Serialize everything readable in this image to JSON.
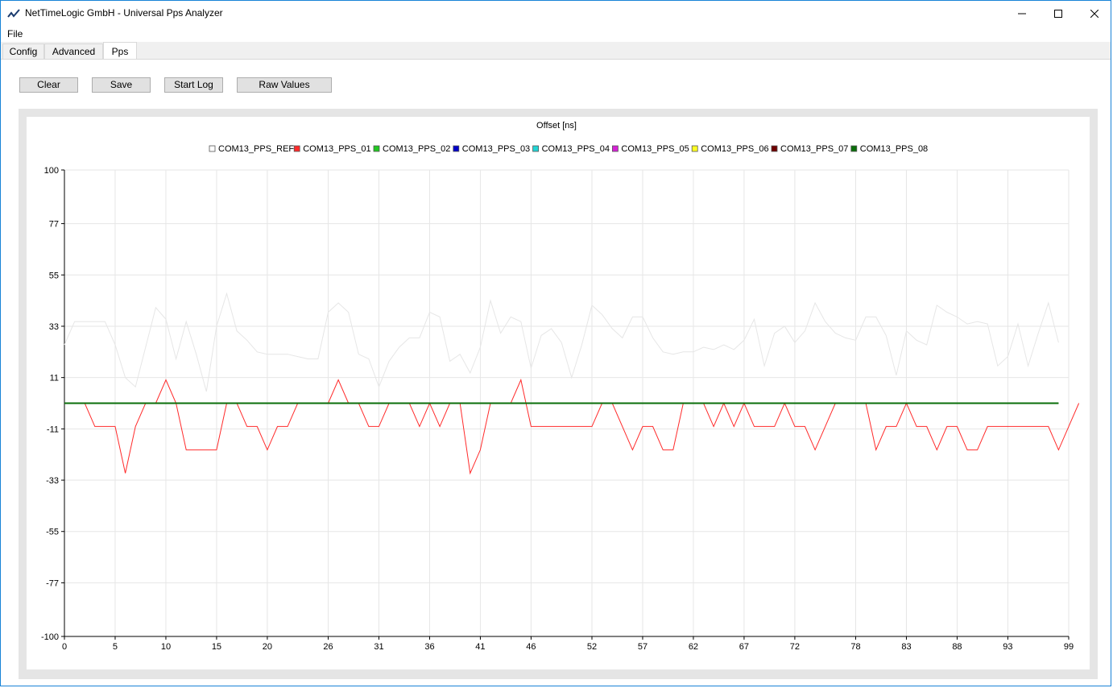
{
  "window": {
    "title": "NetTimeLogic GmbH - Universal Pps Analyzer",
    "accent": "#1883d7"
  },
  "menu": {
    "file": "File"
  },
  "tabs": [
    "Config",
    "Advanced",
    "Pps"
  ],
  "active_tab": "Pps",
  "toolbar": {
    "clear": "Clear",
    "save": "Save",
    "start_log": "Start Log",
    "raw_values": "Raw Values"
  },
  "chart_data": {
    "type": "line",
    "title": "Offset [ns]",
    "ylim": [
      -100,
      100
    ],
    "xlim": [
      0,
      99
    ],
    "yticks": [
      100,
      77,
      55,
      33,
      11,
      -11,
      -33,
      -55,
      -77,
      -100
    ],
    "xticks": [
      0,
      5,
      10,
      15,
      20,
      26,
      31,
      36,
      41,
      46,
      52,
      57,
      62,
      67,
      72,
      78,
      83,
      88,
      93,
      99
    ],
    "grid": true,
    "legend_position": "top",
    "series": [
      {
        "name": "COM13_PPS_REF",
        "color": "#e6e6e6",
        "values": [
          25,
          35,
          35,
          35,
          35,
          25,
          11,
          7,
          24,
          41,
          36,
          19,
          35,
          21,
          5,
          33,
          47,
          31,
          27,
          22,
          21,
          21,
          21,
          20,
          19,
          19,
          39,
          43,
          39,
          21,
          19,
          7,
          18,
          24,
          28,
          28,
          39,
          37,
          18,
          21,
          13,
          24,
          44,
          30,
          37,
          35,
          15,
          29,
          32,
          26,
          11,
          25,
          42,
          38,
          32,
          28,
          37,
          37,
          28,
          22,
          21,
          22,
          22,
          24,
          23,
          25,
          23,
          27,
          36,
          16,
          30,
          33,
          26,
          31,
          43,
          35,
          30,
          28,
          27,
          37,
          37,
          29,
          12,
          31,
          27,
          25,
          42,
          39,
          37,
          34,
          35,
          34,
          16,
          20,
          34,
          16,
          30,
          43,
          26
        ]
      },
      {
        "name": "COM13_PPS_01",
        "color": "#ff2a2a",
        "values": [
          0,
          0,
          0,
          -10,
          -10,
          -10,
          -30,
          -10,
          0,
          0,
          10,
          0,
          -20,
          -20,
          -20,
          -20,
          0,
          0,
          -10,
          -10,
          -20,
          -10,
          -10,
          0,
          0,
          0,
          0,
          10,
          0,
          0,
          -10,
          -10,
          0,
          0,
          0,
          -10,
          0,
          -10,
          0,
          0,
          -30,
          -20,
          0,
          0,
          0,
          10,
          -10,
          -10,
          -10,
          -10,
          -10,
          -10,
          -10,
          0,
          0,
          -10,
          -20,
          -10,
          -10,
          -20,
          -20,
          0,
          0,
          0,
          -10,
          0,
          -10,
          0,
          -10,
          -10,
          -10,
          0,
          -10,
          -10,
          -20,
          -10,
          0,
          0,
          0,
          0,
          -20,
          -10,
          -10,
          0,
          -10,
          -10,
          -20,
          -10,
          -10,
          -20,
          -20,
          -10,
          -10,
          -10,
          -10,
          -10,
          -10,
          -10,
          -20,
          -10,
          0
        ]
      },
      {
        "name": "COM13_PPS_02",
        "color": "#22c822",
        "values": [
          0,
          0
        ]
      },
      {
        "name": "COM13_PPS_03",
        "color": "#0000c8",
        "values": [
          0,
          0
        ]
      },
      {
        "name": "COM13_PPS_04",
        "color": "#22d4d4",
        "values": [
          0,
          0
        ]
      },
      {
        "name": "COM13_PPS_05",
        "color": "#d422d4",
        "values": [
          0,
          0
        ]
      },
      {
        "name": "COM13_PPS_06",
        "color": "#ffff22",
        "values": [
          0,
          0
        ]
      },
      {
        "name": "COM13_PPS_07",
        "color": "#6e0000",
        "values": [
          0,
          0
        ]
      },
      {
        "name": "COM13_PPS_08",
        "color": "#0a6e0a",
        "values": [
          0,
          0
        ]
      }
    ]
  }
}
